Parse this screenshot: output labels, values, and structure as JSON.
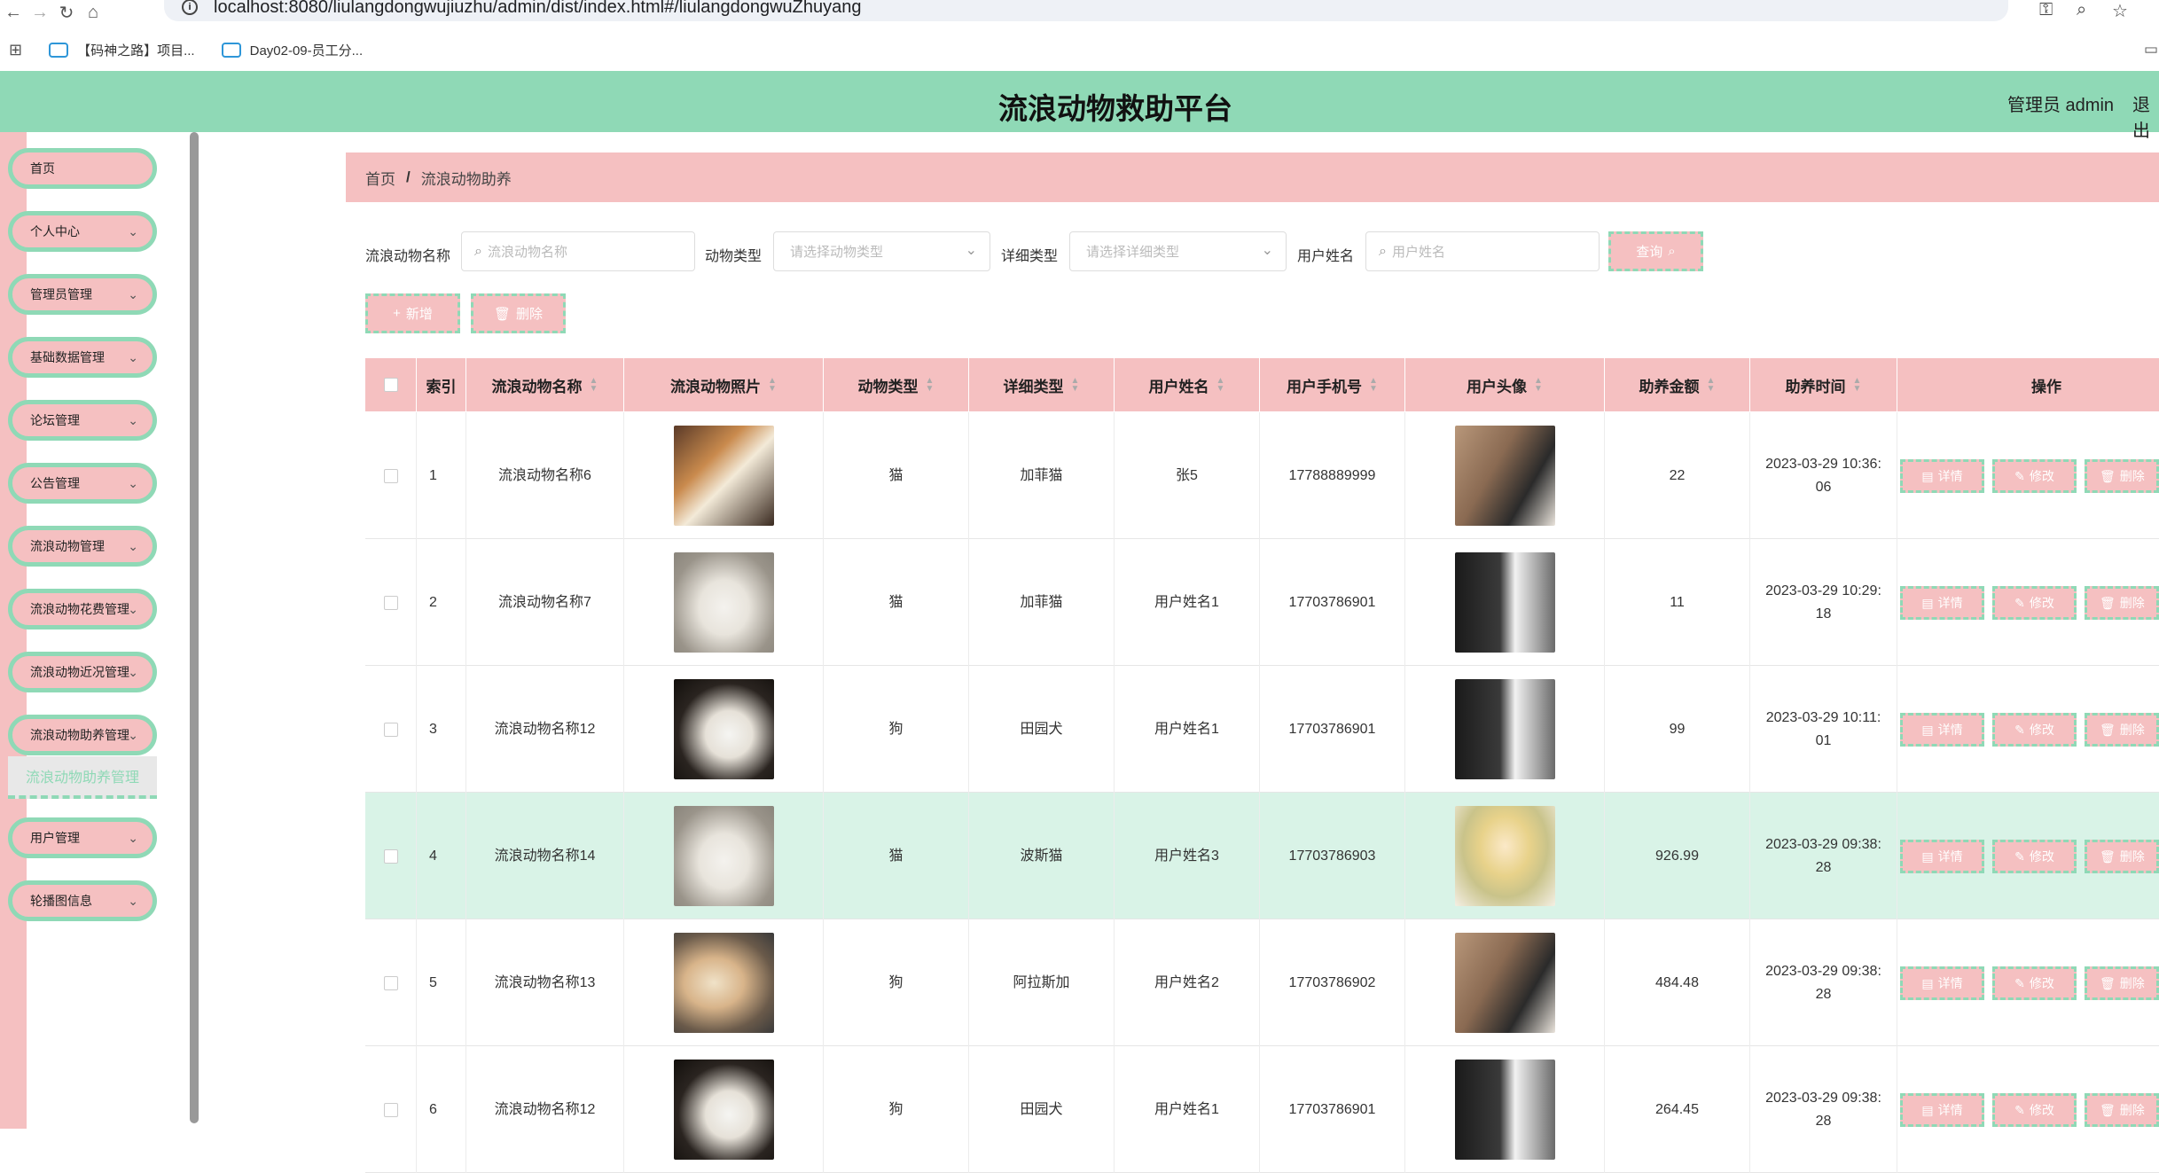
{
  "browser": {
    "url": "localhost:8080/liulangdongwujiuzhu/admin/dist/index.html#/liulangdongwuZhuyang",
    "bookmarks": [
      "【码神之路】项目...",
      "Day02-09-员工分..."
    ]
  },
  "header": {
    "title": "流浪动物救助平台",
    "admin_label": "管理员 admin",
    "logout": "退出"
  },
  "sidebar": {
    "items": [
      {
        "label": "首页"
      },
      {
        "label": "个人中心"
      },
      {
        "label": "管理员管理"
      },
      {
        "label": "基础数据管理"
      },
      {
        "label": "论坛管理"
      },
      {
        "label": "公告管理"
      },
      {
        "label": "流浪动物管理"
      },
      {
        "label": "流浪动物花费管理"
      },
      {
        "label": "流浪动物近况管理"
      },
      {
        "label": "流浪动物助养管理"
      },
      {
        "label": "用户管理"
      },
      {
        "label": "轮播图信息"
      }
    ],
    "active_sub": "流浪动物助养管理"
  },
  "breadcrumb": {
    "home": "首页",
    "current": "流浪动物助养"
  },
  "filters": {
    "name_label": "流浪动物名称",
    "name_placeholder": "流浪动物名称",
    "type_label": "动物类型",
    "type_placeholder": "请选择动物类型",
    "detail_label": "详细类型",
    "detail_placeholder": "请选择详细类型",
    "user_label": "用户姓名",
    "user_placeholder": "用户姓名",
    "search_btn": "查询"
  },
  "toolbar": {
    "add": "新增",
    "delete": "删除"
  },
  "table": {
    "headers": [
      "索引",
      "流浪动物名称",
      "流浪动物照片",
      "动物类型",
      "详细类型",
      "用户姓名",
      "用户手机号",
      "用户头像",
      "助养金额",
      "助养时间",
      "操作"
    ],
    "actions": {
      "detail": "详情",
      "edit": "修改",
      "delete": "删除"
    },
    "rows": [
      {
        "idx": "1",
        "name": "流浪动物名称6",
        "type": "猫",
        "detail": "加菲猫",
        "user": "张5",
        "phone": "17788889999",
        "amount": "22",
        "time": "2023-03-29 10:36:06",
        "time_l1": "2023-03-29 10:36:",
        "time_l2": "06"
      },
      {
        "idx": "2",
        "name": "流浪动物名称7",
        "type": "猫",
        "detail": "加菲猫",
        "user": "用户姓名1",
        "phone": "17703786901",
        "amount": "11",
        "time": "2023-03-29 10:29:18",
        "time_l1": "2023-03-29 10:29:",
        "time_l2": "18"
      },
      {
        "idx": "3",
        "name": "流浪动物名称12",
        "type": "狗",
        "detail": "田园犬",
        "user": "用户姓名1",
        "phone": "17703786901",
        "amount": "99",
        "time": "2023-03-29 10:11:01",
        "time_l1": "2023-03-29 10:11:",
        "time_l2": "01"
      },
      {
        "idx": "4",
        "name": "流浪动物名称14",
        "type": "猫",
        "detail": "波斯猫",
        "user": "用户姓名3",
        "phone": "17703786903",
        "amount": "926.99",
        "time": "2023-03-29 09:38:28",
        "time_l1": "2023-03-29 09:38:",
        "time_l2": "28"
      },
      {
        "idx": "5",
        "name": "流浪动物名称13",
        "type": "狗",
        "detail": "阿拉斯加",
        "user": "用户姓名2",
        "phone": "17703786902",
        "amount": "484.48",
        "time": "2023-03-29 09:38:28",
        "time_l1": "2023-03-29 09:38:",
        "time_l2": "28"
      },
      {
        "idx": "6",
        "name": "流浪动物名称12",
        "type": "狗",
        "detail": "田园犬",
        "user": "用户姓名1",
        "phone": "17703786901",
        "amount": "264.45",
        "time": "2023-03-29 09:38:28",
        "time_l1": "2023-03-29 09:38:",
        "time_l2": "28"
      }
    ]
  },
  "colors": {
    "accent_green": "#8fd9b6",
    "accent_pink": "#f5c0c1",
    "highlight_row": "#d9f3e7"
  }
}
